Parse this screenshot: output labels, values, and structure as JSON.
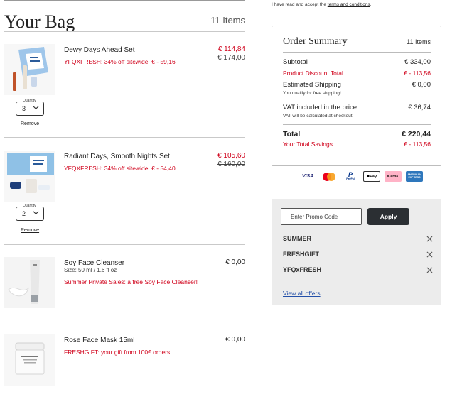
{
  "bag": {
    "title": "Your Bag",
    "count": "11 Items"
  },
  "items": [
    {
      "name": "Dewy Days Ahead Set",
      "promo": "YFQXFRESH: 34% off sitewide! € - 59,16",
      "price": "€ 114,84",
      "old_price": "€ 174,00",
      "quantity_label": "Quantity",
      "quantity": "3",
      "remove": "Remove"
    },
    {
      "name": "Radiant Days, Smooth Nights Set",
      "promo": "YFQXFRESH: 34% off sitewide! € - 54,40",
      "price": "€ 105,60",
      "old_price": "€ 160,00",
      "quantity_label": "Quantity",
      "quantity": "2",
      "remove": "Remove"
    },
    {
      "name": "Soy Face Cleanser",
      "size": "Size: 50 ml / 1.6 fl oz",
      "promo": "Summer Private Sales: a free Soy Face Cleanser!",
      "price": "€ 0,00"
    },
    {
      "name": "Rose Face Mask 15ml",
      "promo": "FRESHGIFT: your gift from 100€ orders!",
      "price": "€ 0,00"
    }
  ],
  "terms": {
    "text": "I have read and accept the ",
    "link": "terms and conditions",
    "end": "."
  },
  "summary": {
    "title": "Order Summary",
    "count": "11 Items",
    "subtotal_label": "Subtotal",
    "subtotal": "€ 334,00",
    "discount_label": "Product Discount Total",
    "discount": "€ - 113,56",
    "shipping_label": "Estimated Shipping",
    "shipping": "€ 0,00",
    "shipping_note": "You qualify for free shipping!",
    "vat_label": "VAT included in the price",
    "vat": "€ 36,74",
    "vat_note": "VAT will be calculated at checkout",
    "total_label": "Total",
    "total": "€ 220,44",
    "savings_label": "Your Total Savings",
    "savings": "€ - 113,56"
  },
  "payments": [
    {
      "label": "VISA",
      "icon": "visa-icon"
    },
    {
      "label": "",
      "icon": "mastercard-icon"
    },
    {
      "label": "PayPal",
      "icon": "paypal-icon"
    },
    {
      "label": "Pay",
      "icon": "apple-pay-icon"
    },
    {
      "label": "Klarna.",
      "icon": "klarna-icon"
    },
    {
      "label": "AMERICAN EXPRESS",
      "icon": "amex-icon"
    }
  ],
  "promo": {
    "placeholder": "Enter Promo Code",
    "apply": "Apply",
    "codes": [
      "SUMMER",
      "FRESHGIFT",
      "YFQxFRESH"
    ],
    "view_all": "View all offers"
  },
  "colors": {
    "accent_red": "#d0021b",
    "button_dark": "#2b2f33",
    "panel_bg": "#ececec",
    "link_blue": "#2450a8"
  }
}
